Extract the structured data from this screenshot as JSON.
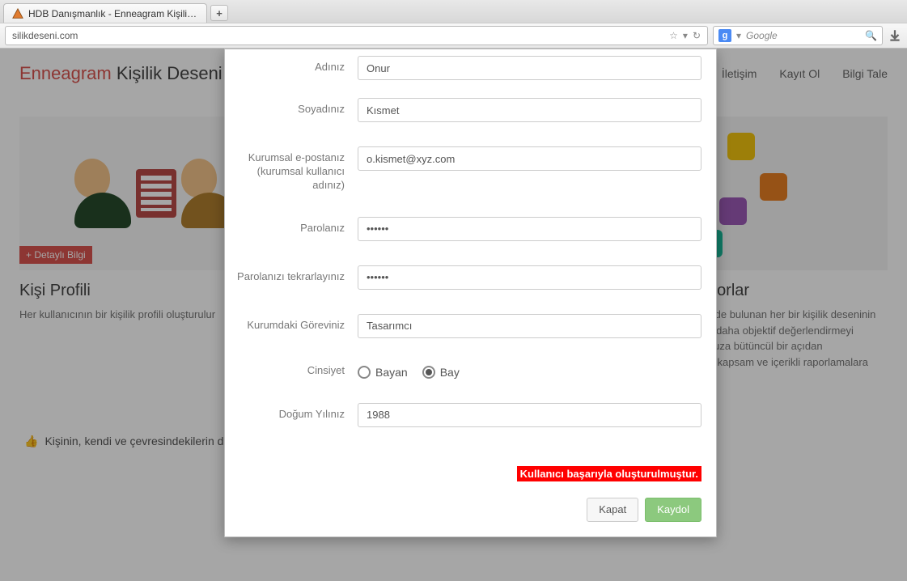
{
  "browser": {
    "tab_title": "HDB Danışmanlık - Enneagram Kişilik De...",
    "url": "silikdeseni.com",
    "search_placeholder": "Google"
  },
  "page": {
    "brand_red": "Enneagram",
    "brand_rest": "Kişilik Deseni Analiz",
    "nav": {
      "contact": "İletişim",
      "register": "Kayıt Ol",
      "info": "Bilgi Tale"
    },
    "detail_btn": "+ Detaylı Bilgi",
    "card_left": {
      "title": "Kişi Profili",
      "desc": "Her kullanıcının bir kişilik profili oluşturulur"
    },
    "card_right": {
      "title": "Kurumsal Raporlar",
      "desc": "Organizasyon içerisinde bulunan her bir kişilik deseninin kuruma kattığı değeri daha objektif değerlendirmeyi sağlayacak, kurumunuza bütüncül bir açıdan bakabileceğiniz geniş kapsam ve içerikli raporlamalara ulaşabilirsiniz."
    },
    "bottom_line": "Kişinin, kendi ve çevresindekilerin duygularını anlama ve davranışlarını kontrol etme kapasitesini artırır."
  },
  "form": {
    "labels": {
      "name": "Adınız",
      "surname": "Soyadınız",
      "email": "Kurumsal e-postanız (kurumsal kullanıcı adınız)",
      "password": "Parolanız",
      "password2": "Parolanızı tekrarlayınız",
      "role": "Kurumdaki Göreviniz",
      "gender": "Cinsiyet",
      "birth": "Doğum Yılınız"
    },
    "values": {
      "name": "Onur",
      "surname": "Kısmet",
      "email": "o.kismet@xyz.com",
      "password": "••••••",
      "password2": "••••••",
      "role": "Tasarımcı",
      "birth": "1988"
    },
    "gender": {
      "female": "Bayan",
      "male": "Bay",
      "selected": "male"
    },
    "success": "Kullanıcı başarıyla oluşturulmuştur.",
    "buttons": {
      "close": "Kapat",
      "save": "Kaydol"
    }
  }
}
